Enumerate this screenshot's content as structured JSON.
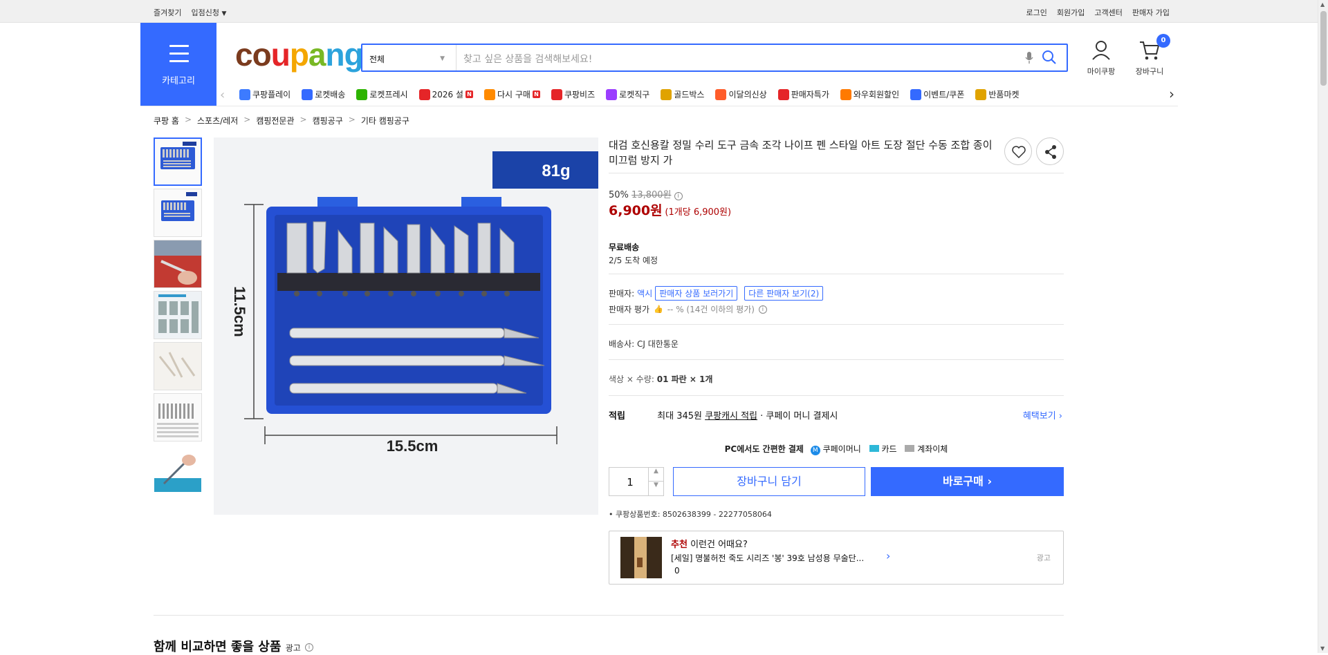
{
  "topbar": {
    "left": [
      "즐겨찾기",
      "입점신청"
    ],
    "right": [
      "로그인",
      "회원가입",
      "고객센터",
      "판매자 가입"
    ]
  },
  "header": {
    "category_label": "카테고리",
    "logo": "coupang",
    "search_select": "전체",
    "search_placeholder": "찾고 싶은 상품을 검색해보세요!",
    "mycoupang_label": "마이쿠팡",
    "cart_label": "장바구니",
    "cart_count": "0"
  },
  "nav": {
    "items": [
      {
        "label": "쿠팡플레이",
        "icon": "play-icon",
        "color": "#3d7bff"
      },
      {
        "label": "로켓배송",
        "icon": "rocket-icon",
        "color": "#346aff"
      },
      {
        "label": "로켓프레시",
        "icon": "rocket-fresh-icon",
        "color": "#2db400"
      },
      {
        "label": "2026 설",
        "icon": "gift-icon",
        "color": "#e52528",
        "new": "N"
      },
      {
        "label": "다시 구매",
        "icon": "home-icon",
        "color": "#ff8a00",
        "new": "N"
      },
      {
        "label": "쿠팡비즈",
        "icon": "biz-icon",
        "color": "#e52528"
      },
      {
        "label": "로켓직구",
        "icon": "rocket-global-icon",
        "color": "#9b3dff"
      },
      {
        "label": "골드박스",
        "icon": "goldbox-icon",
        "color": "#e0a300"
      },
      {
        "label": "이달의신상",
        "icon": "new-bag-icon",
        "color": "#ff5c2a"
      },
      {
        "label": "판매자특가",
        "icon": "percent-icon",
        "color": "#e52528"
      },
      {
        "label": "와우회원할인",
        "icon": "wow-icon",
        "color": "#ff7a00"
      },
      {
        "label": "이벤트/쿠폰",
        "icon": "coupon-icon",
        "color": "#346aff"
      },
      {
        "label": "반품마켓",
        "icon": "market-icon",
        "color": "#e0a300"
      }
    ]
  },
  "breadcrumb": [
    "쿠팡 홈",
    "스포츠/레저",
    "캠핑전문관",
    "캠핑공구",
    "기타 캠핑공구"
  ],
  "image": {
    "weight_label": "81g",
    "height_label": "11.5cm",
    "width_label": "15.5cm"
  },
  "product": {
    "title": "대검 호신용칼 정밀 수리 도구 금속 조각 나이프 펜 스타일 아트 도장 절단 수동 조합 종이 미끄럼 방지 가",
    "discount": "50%",
    "original_price": "13,800원",
    "price": "6,900원",
    "unit_price": "(1개당 6,900원)",
    "shipping_title": "무료배송",
    "shipping_date": "2/5 도착 예정",
    "seller_label": "판매자:",
    "seller_name": "액시",
    "seller_products_btn": "판매자 상품 보러가기",
    "other_sellers_btn": "다른 판매자 보기(2)",
    "seller_rating_label": "판매자 평가",
    "seller_rating_value": "-- % (14건 이하의 평가)",
    "carrier": "배송사:  CJ 대한통운",
    "option": "색상 × 수량:",
    "option_value": "01 파란 × 1개",
    "reward_label": "적립",
    "reward_text_1": "최대 345원",
    "reward_text_2": "쿠팡캐시 적립",
    "reward_text_3": "· 쿠페이 머니 결제시",
    "benefit_link": "혜택보기",
    "pay_title": "PC에서도 간편한 결제",
    "pay_methods": [
      "쿠페이머니",
      "카드",
      "계좌이체"
    ],
    "quantity": "1",
    "cart_button": "장바구니 담기",
    "buy_button": "바로구매",
    "product_no": "쿠팡상품번호: 8502638399 - 22277058064"
  },
  "recommend": {
    "prefix": "추천",
    "title": "이런건 어때요?",
    "item": "[세일] 명불허전 죽도 시리즈 '봉' 39호 남성용 무술단...",
    "price": "0",
    "ad": "광고"
  },
  "compare": {
    "title": "함께 비교하면 좋을 상품",
    "ad": "광고"
  },
  "colors": {
    "accent": "#346aff",
    "price_red": "#ae0000"
  }
}
